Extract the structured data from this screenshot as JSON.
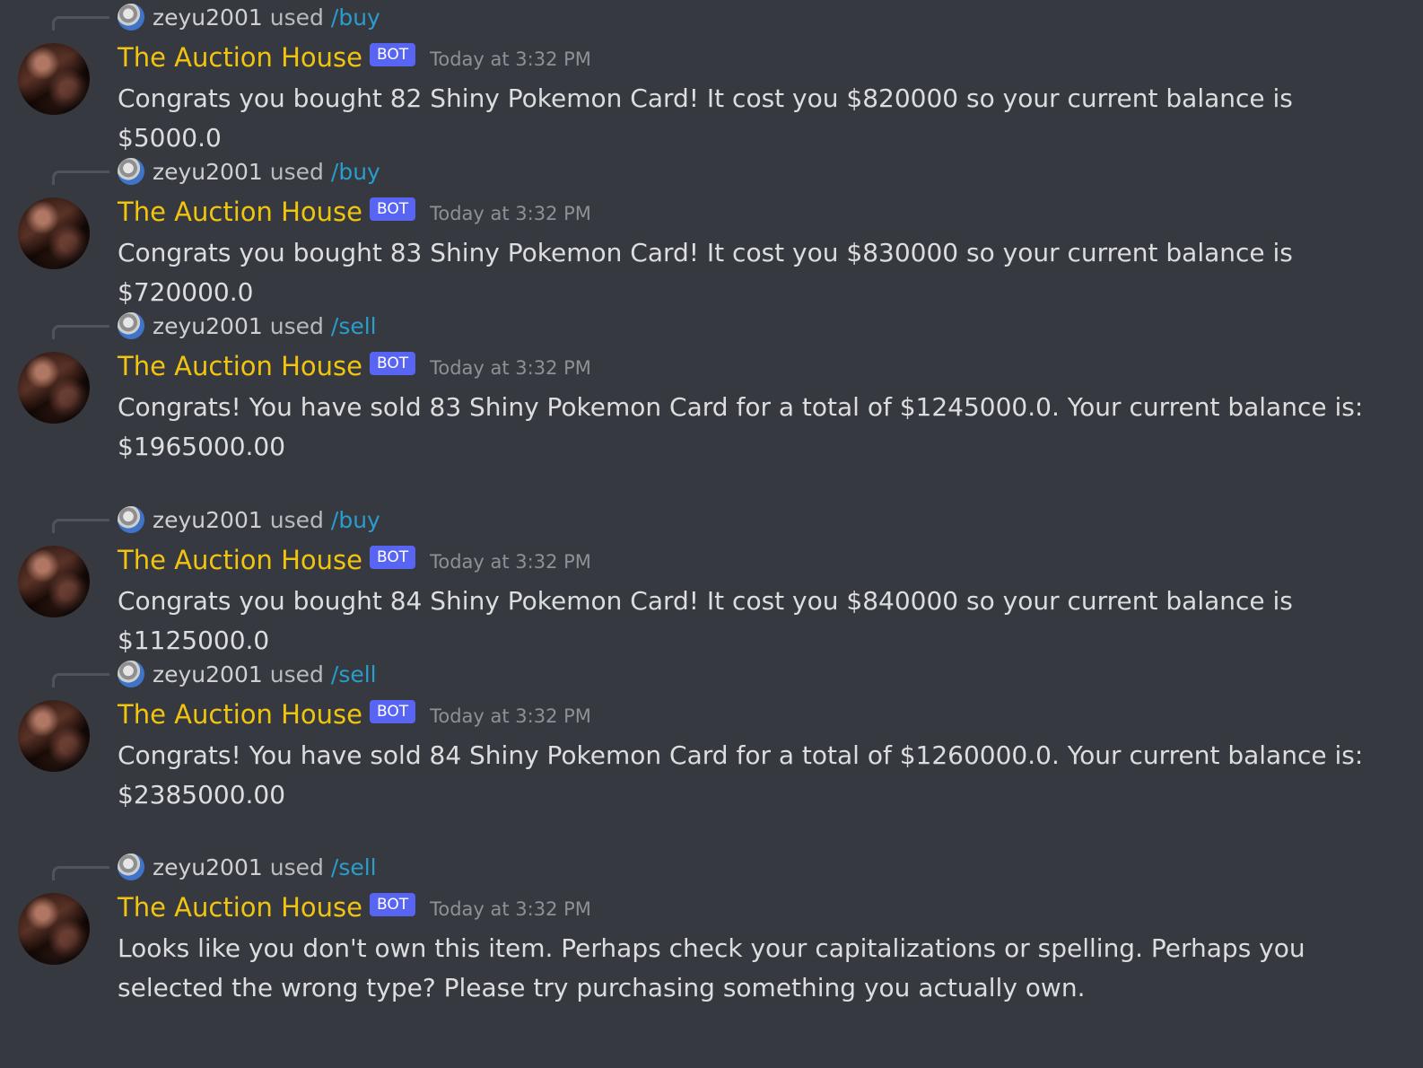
{
  "messages": [
    {
      "reply": {
        "user": "zeyu2001",
        "used": "used",
        "command": "/buy"
      },
      "author": "The Auction House",
      "badge": "BOT",
      "timestamp": "Today at 3:32 PM",
      "text": "Congrats you bought 82 Shiny Pokemon Card! It cost you $820000 so your current balance is $5000.0"
    },
    {
      "reply": {
        "user": "zeyu2001",
        "used": "used",
        "command": "/buy"
      },
      "author": "The Auction House",
      "badge": "BOT",
      "timestamp": "Today at 3:32 PM",
      "text": "Congrats you bought 83 Shiny Pokemon Card! It cost you $830000 so your current balance is $720000.0"
    },
    {
      "reply": {
        "user": "zeyu2001",
        "used": "used",
        "command": "/sell"
      },
      "author": "The Auction House",
      "badge": "BOT",
      "timestamp": "Today at 3:32 PM",
      "text": "Congrats! You have sold 83 Shiny Pokemon Card for a total of $1245000.0. Your current balance is: $1965000.00"
    },
    {
      "reply": {
        "user": "zeyu2001",
        "used": "used",
        "command": "/buy"
      },
      "author": "The Auction House",
      "badge": "BOT",
      "timestamp": "Today at 3:32 PM",
      "text": "Congrats you bought 84 Shiny Pokemon Card! It cost you $840000 so your current balance is $1125000.0"
    },
    {
      "reply": {
        "user": "zeyu2001",
        "used": "used",
        "command": "/sell"
      },
      "author": "The Auction House",
      "badge": "BOT",
      "timestamp": "Today at 3:32 PM",
      "text": "Congrats! You have sold 84 Shiny Pokemon Card for a total of $1260000.0. Your current balance is: $2385000.00"
    },
    {
      "reply": {
        "user": "zeyu2001",
        "used": "used",
        "command": "/sell"
      },
      "author": "The Auction House",
      "badge": "BOT",
      "timestamp": "Today at 3:32 PM",
      "text": "Looks like you don't own this item. Perhaps check your capitalizations or spelling. Perhaps you selected the wrong type? Please try purchasing something you actually own."
    }
  ],
  "colors": {
    "background": "#36393f",
    "author": "#f1c40f",
    "bot_badge": "#5865f2",
    "command": "#00aff4",
    "timestamp": "#8e9297",
    "text": "#dcddde"
  },
  "icons": {
    "reply_avatar": "user-avatar-icon",
    "bot_avatar": "bot-avatar-icon"
  }
}
